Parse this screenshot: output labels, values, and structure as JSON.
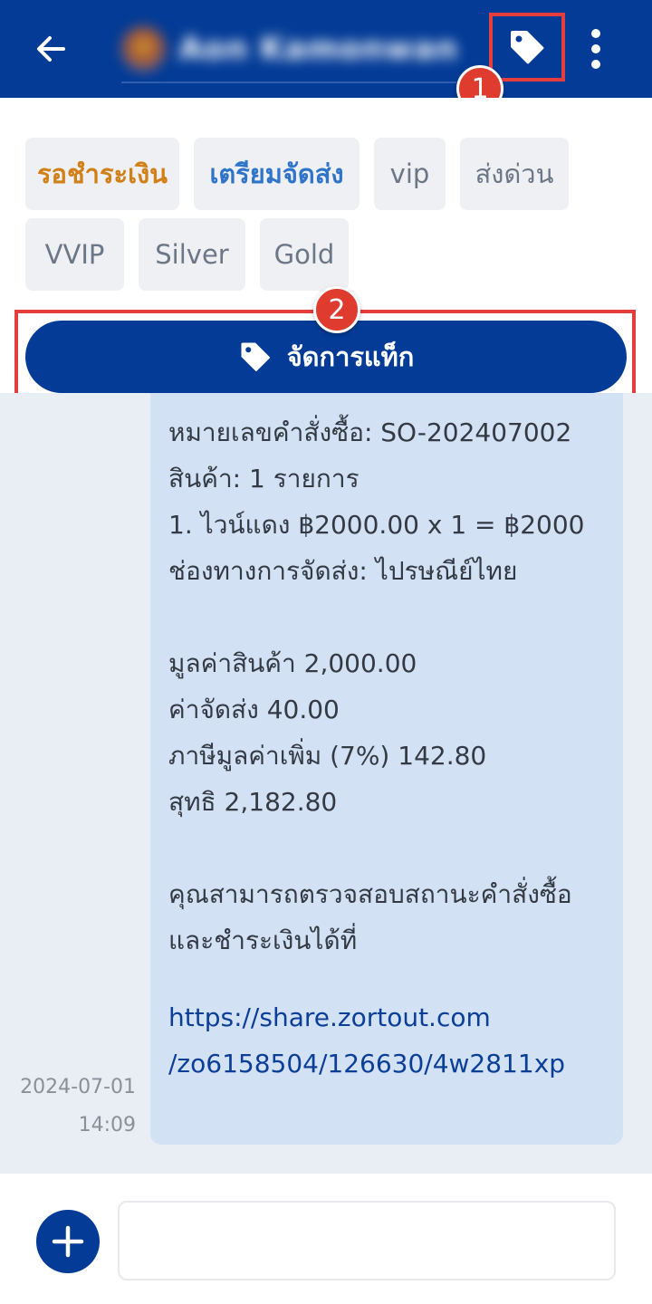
{
  "header": {
    "contact_name": "Aon Kamonwan",
    "back_icon": "arrow-left-icon",
    "tag_icon": "tag-icon",
    "more_icon": "more-vertical-icon",
    "background": "#033b96"
  },
  "annotations": {
    "marker_1": "1",
    "marker_2": "2"
  },
  "tags": {
    "items": [
      {
        "label": "รอชำระเงิน",
        "color": "#d17f17"
      },
      {
        "label": "เตรียมจัดส่ง",
        "color": "#2f74c9"
      },
      {
        "label": "vip"
      },
      {
        "label": "ส่งด่วน"
      },
      {
        "label": "VVIP"
      },
      {
        "label": "Silver"
      },
      {
        "label": "Gold"
      }
    ],
    "manage_label": "จัดการแท็ก"
  },
  "message": {
    "lines": [
      "หมายเลขคำสั่งซื้อ: SO-202407002",
      "สินค้า: 1 รายการ",
      "1. ไวน์แดง ฿2000.00 x 1 = ฿2000",
      "ช่องทางการจัดส่ง: ไปรษณีย์ไทย",
      "มูลค่าสินค้า 2,000.00",
      "ค่าจัดส่ง 40.00",
      "ภาษีมูลค่าเพิ่ม (7%) 142.80",
      "สุทธิ 2,182.80",
      "คุณสามารถตรวจสอบสถานะคำสั่งซื้อ",
      "และชำระเงินได้ที่"
    ],
    "link_lines": [
      "https://share.zortout.com",
      "/zo6158504/126630/4w2811xp"
    ],
    "date": "2024-07-01",
    "time": "14:09"
  },
  "footer": {
    "add_icon": "plus-icon",
    "input_value": "",
    "input_placeholder": ""
  }
}
